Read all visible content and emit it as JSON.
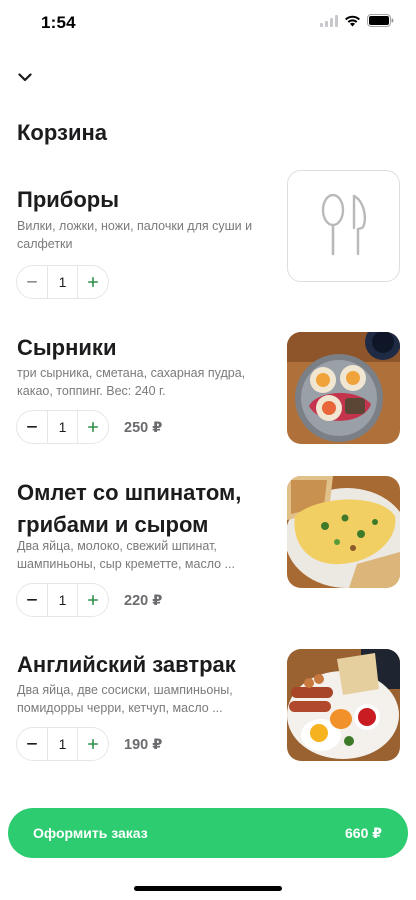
{
  "status_bar": {
    "time": "1:54"
  },
  "header": {
    "title": "Корзина"
  },
  "items": [
    {
      "title": "Приборы",
      "description": "Вилки, ложки, ножи, палочки для суши и салфетки",
      "quantity": "1",
      "price": "",
      "image": "cutlery-icon"
    },
    {
      "title": "Сырники",
      "description": "три сырника, сметана, сахарная пудра, какао, топпинг. Вес: 240 г.",
      "quantity": "1",
      "price": "250 ₽",
      "image": "syrniki-photo"
    },
    {
      "title": "Омлет со шпинатом, грибами и сыром",
      "description": "Два яйца, молоко, свежий шпинат, шампиньоны, сыр креметте, масло ...",
      "quantity": "1",
      "price": "220 ₽",
      "image": "omelette-photo"
    },
    {
      "title": "Английский завтрак",
      "description": "Два яйца, две сосиски, шампиньоны, помидорры черри, кетчуп, масло ...",
      "quantity": "1",
      "price": "190 ₽",
      "image": "english-breakfast-photo"
    }
  ],
  "checkout": {
    "label": "Оформить заказ",
    "total": "660 ₽"
  },
  "colors": {
    "accent": "#2ecc71",
    "stepper_plus": "#2f8f4a"
  }
}
